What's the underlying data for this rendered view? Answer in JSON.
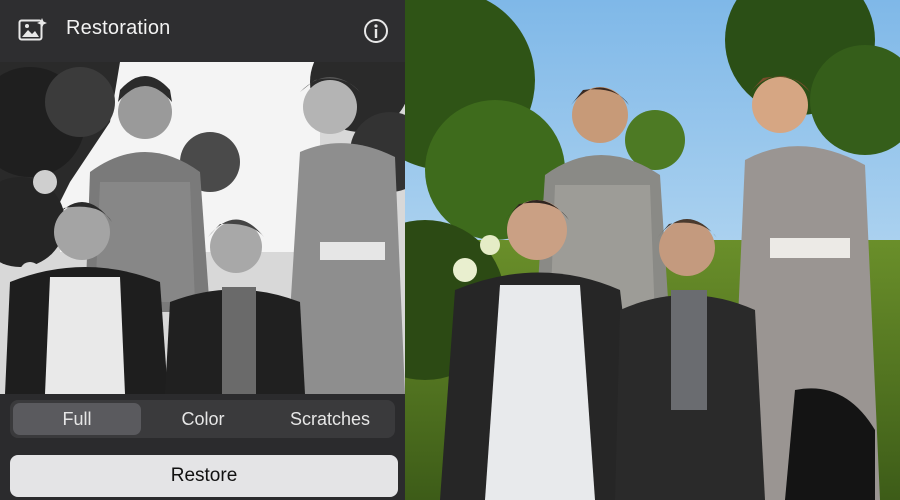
{
  "app": {
    "title": "Restoration",
    "icon": "photo-icon",
    "info_icon": "info-icon"
  },
  "modes": {
    "options": [
      "Full",
      "Color",
      "Scratches"
    ],
    "selected": "Full"
  },
  "actions": {
    "restore_label": "Restore"
  },
  "colors": {
    "panel_bg": "#2b2b2d",
    "segment_bg": "#3a3a3c",
    "segment_active": "#5a5a5e",
    "button_bg": "#e4e4e6",
    "sky": "#a9d3f0",
    "foliage": "#3f6e22"
  },
  "images": {
    "original": "black-and-white photo of four women in Victorian dresses",
    "restored": "colorized restored version of the same photo"
  }
}
